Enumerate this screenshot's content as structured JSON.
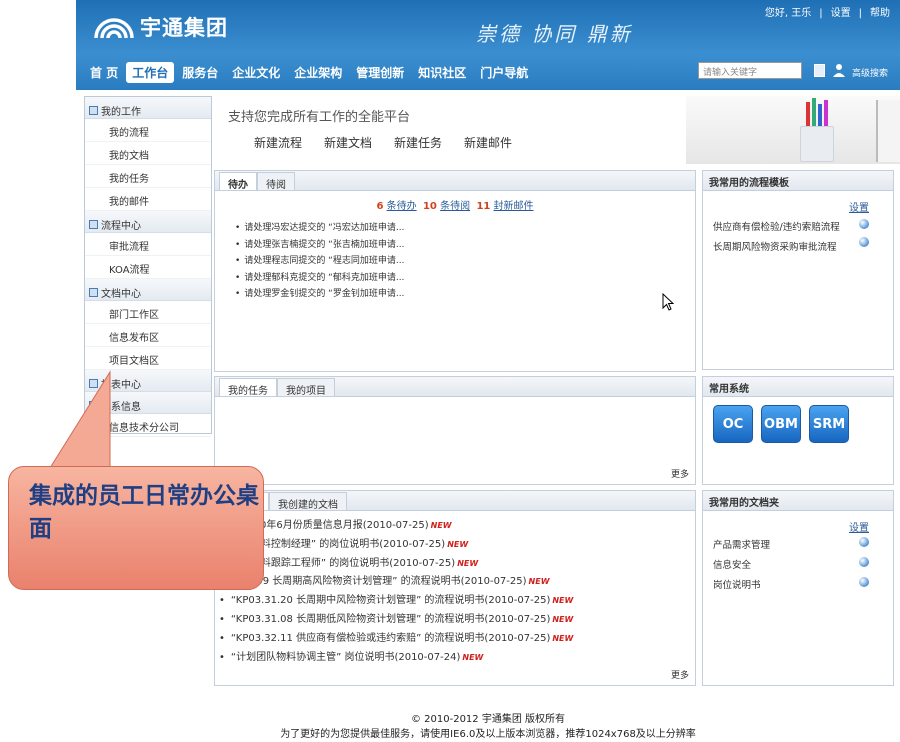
{
  "header": {
    "logo_text": "宇通集团",
    "slogan": "崇德 协同 鼎新",
    "toplinks": [
      "您好, 王乐",
      "|",
      "设置",
      "|",
      "帮助"
    ],
    "nav": [
      "首 页",
      "工作台",
      "服务台",
      "企业文化",
      "企业架构",
      "管理创新",
      "知识社区",
      "门户导航"
    ],
    "nav_active": "工作台",
    "search_placeholder": "请输入关键字",
    "advanced_search": "高级搜索"
  },
  "sidebar": {
    "groups": [
      {
        "title": "我的工作",
        "items": [
          "我的流程",
          "我的文档",
          "我的任务",
          "我的邮件"
        ]
      },
      {
        "title": "流程中心",
        "items": [
          "审批流程",
          "KOA流程"
        ]
      },
      {
        "title": "文档中心",
        "items": [
          "部门工作区",
          "信息发布区",
          "项目文档区"
        ]
      },
      {
        "title": "报表中心",
        "items": []
      },
      {
        "title": "体系信息",
        "items": [
          "信息技术分公司"
        ]
      }
    ]
  },
  "main": {
    "platform_title": "支持您完成所有工作的全能平台",
    "actions": [
      "新建流程",
      "新建文档",
      "新建任务",
      "新建邮件"
    ],
    "todo_panel": {
      "tabs": [
        "待办",
        "待阅"
      ],
      "summary": [
        {
          "count": "6",
          "label": "条待办"
        },
        {
          "count": "10",
          "label": "条待阅"
        },
        {
          "count": "11",
          "label": "封新邮件"
        }
      ],
      "items": [
        "请处理冯宏达提交的 “冯宏达加班申请...",
        "请处理张吉楠提交的 “张吉楠加班申请...",
        "请处理程志同提交的 “程志同加班申请...",
        "请处理郁科克提交的 “郁科克加班申请...",
        "请处理罗金钊提交的 “罗金钊加班申请..."
      ]
    },
    "task_panel": {
      "tabs": [
        "我的任务",
        "我的项目"
      ],
      "more": "更多"
    },
    "doc_panel": {
      "tabs": [
        "",
        "我创建的文档"
      ],
      "items": [
        {
          "text": "师2010年6月份质量信息月报(2010-07-25)",
          "new": "NEW"
        },
        {
          "text": "团队物料控制经理” 的岗位说明书(2010-07-25)",
          "new": "NEW"
        },
        {
          "text": "团队物料跟踪工程师” 的岗位说明书(2010-07-25)",
          "new": "NEW"
        },
        {
          "text": "3.31.09 长周期高风险物资计划管理” 的流程说明书(2010-07-25)",
          "new": "NEW"
        },
        {
          "text": "“KP03.31.20 长周期中风险物资计划管理” 的流程说明书(2010-07-25)",
          "new": "NEW"
        },
        {
          "text": "“KP03.31.08 长周期低风险物资计划管理” 的流程说明书(2010-07-25)",
          "new": "NEW"
        },
        {
          "text": "“KP03.32.11 供应商有偿检验或违约索赔” 的流程说明书(2010-07-25)",
          "new": "NEW"
        },
        {
          "text": "“计划团队物料协调主管” 岗位说明书(2010-07-24)",
          "new": "NEW"
        }
      ],
      "more": "更多"
    }
  },
  "right": {
    "templates": {
      "title": "我常用的流程模板",
      "setting": "设置",
      "items": [
        "供应商有偿检验/违约索赔流程",
        "长周期风险物资采购审批流程"
      ]
    },
    "systems": {
      "title": "常用系统",
      "buttons": [
        "OC",
        "OBM",
        "SRM"
      ]
    },
    "folders": {
      "title": "我常用的文档夹",
      "setting": "设置",
      "items": [
        "产品需求管理",
        "信息安全",
        "岗位说明书"
      ]
    }
  },
  "footer": {
    "copyright": "© 2010-2012 宇通集团 版权所有",
    "note": "为了更好的为您提供最佳服务，请使用IE6.0及以上版本浏览器，推荐1024x768及以上分辨率"
  },
  "callout": {
    "text": "集成的员工日常办公桌面"
  },
  "colors": {
    "header_blue": "#2a7cc0",
    "callout_fill": "#ee9a84",
    "callout_text": "#1f3f85",
    "new_red": "#d0201c"
  }
}
